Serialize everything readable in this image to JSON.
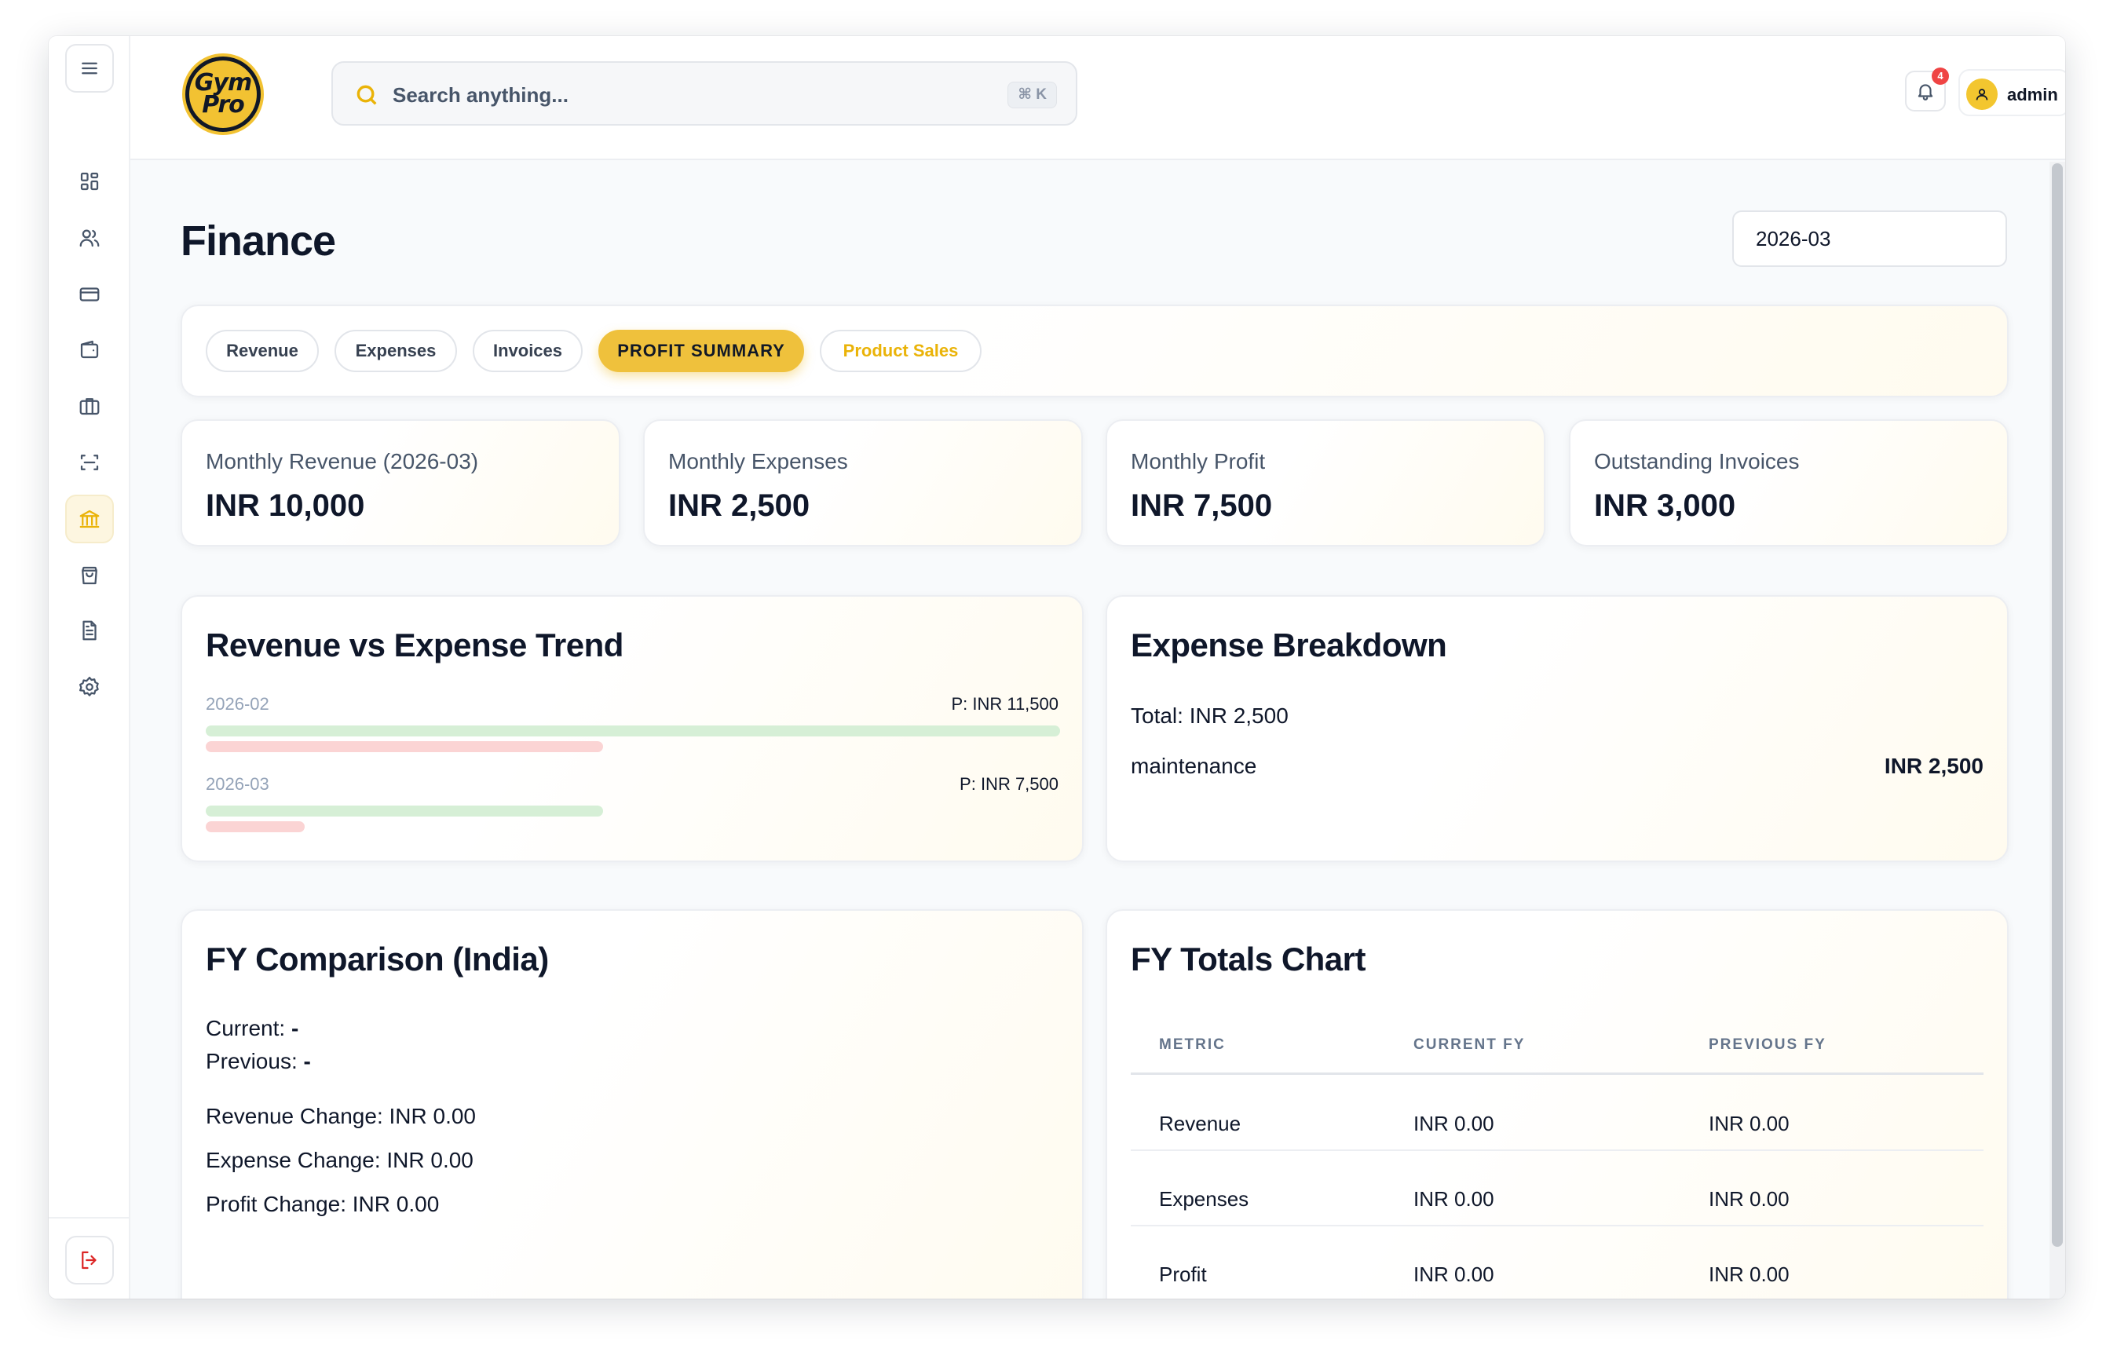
{
  "app": {
    "logo_line1": "Gym",
    "logo_line2": "Pro"
  },
  "search": {
    "placeholder": "Search anything...",
    "shortcut": "⌘ K"
  },
  "notifications": {
    "count": "4"
  },
  "user": {
    "name": "admin"
  },
  "sidebar": {
    "items": [
      {
        "icon": "dashboard-icon"
      },
      {
        "icon": "users-icon"
      },
      {
        "icon": "credit-card-icon"
      },
      {
        "icon": "wallet-icon"
      },
      {
        "icon": "briefcase-icon"
      },
      {
        "icon": "scan-icon"
      },
      {
        "icon": "bank-icon",
        "active": true
      },
      {
        "icon": "shopping-bag-icon"
      },
      {
        "icon": "document-icon"
      },
      {
        "icon": "settings-icon"
      }
    ],
    "logout_icon": "logout-icon"
  },
  "page": {
    "title": "Finance",
    "month": "2026-03"
  },
  "tabs": [
    {
      "label": "Revenue"
    },
    {
      "label": "Expenses"
    },
    {
      "label": "Invoices"
    },
    {
      "label": "PROFIT SUMMARY",
      "active": true
    },
    {
      "label": "Product Sales"
    }
  ],
  "stats": [
    {
      "label": "Monthly Revenue (2026-03)",
      "value": "INR 10,000"
    },
    {
      "label": "Monthly Expenses",
      "value": "INR 2,500"
    },
    {
      "label": "Monthly Profit",
      "value": "INR 7,500"
    },
    {
      "label": "Outstanding Invoices",
      "value": "INR 3,000"
    }
  ],
  "trend": {
    "title": "Revenue vs Expense Trend",
    "rows": [
      {
        "month": "2026-02",
        "profit_label": "P: INR 11,500",
        "revenue_fraction": 1.0,
        "expense_fraction": 0.465
      },
      {
        "month": "2026-03",
        "profit_label": "P: INR 7,500",
        "revenue_fraction": 0.465,
        "expense_fraction": 0.116
      }
    ]
  },
  "breakdown": {
    "title": "Expense Breakdown",
    "total": "Total: INR 2,500",
    "items": [
      {
        "category": "maintenance",
        "amount": "INR 2,500"
      }
    ]
  },
  "fy_comparison": {
    "title": "FY Comparison (India)",
    "current_label": "Current:",
    "current_value": "-",
    "previous_label": "Previous:",
    "previous_value": "-",
    "revenue_change": "Revenue Change: INR 0.00",
    "expense_change": "Expense Change: INR 0.00",
    "profit_change": "Profit Change: INR 0.00"
  },
  "fy_totals": {
    "title": "FY Totals Chart",
    "columns": [
      "METRIC",
      "CURRENT FY",
      "PREVIOUS FY"
    ],
    "rows": [
      {
        "metric": "Revenue",
        "current": "INR 0.00",
        "previous": "INR 0.00"
      },
      {
        "metric": "Expenses",
        "current": "INR 0.00",
        "previous": "INR 0.00"
      },
      {
        "metric": "Profit",
        "current": "INR 0.00",
        "previous": "INR 0.00"
      }
    ]
  },
  "colors": {
    "accent": "#efc13c",
    "revenue_bar": "#d6efd6",
    "expense_bar": "#fbd4d4"
  }
}
